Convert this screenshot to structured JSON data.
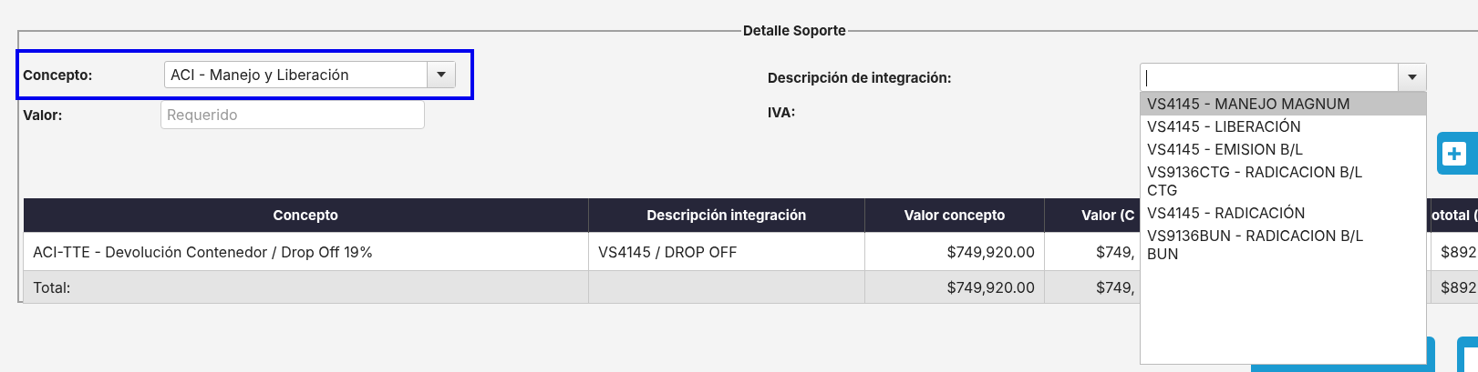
{
  "legend": "Detalle Soporte",
  "concepto": {
    "label": "Concepto:",
    "value": "ACI - Manejo y Liberación",
    "highlighted": true
  },
  "valor": {
    "label": "Valor:",
    "placeholder": "Requerido"
  },
  "descripcion": {
    "label": "Descripción de integración:",
    "expanded": true,
    "options": [
      {
        "label": "VS4145 - MANEJO MAGNUM",
        "selected": true
      },
      {
        "label": "VS4145 - LIBERACIÓN",
        "selected": false
      },
      {
        "label": "VS4145 - EMISION B/L",
        "selected": false
      },
      {
        "label": "VS9136CTG - RADICACION B/L CTG",
        "selected": false
      },
      {
        "label": "VS4145 - RADICACIÓN",
        "selected": false
      },
      {
        "label": "VS9136BUN - RADICACION B/L BUN",
        "selected": false
      }
    ]
  },
  "iva": {
    "label": "IVA:"
  },
  "table": {
    "columns": [
      "Concepto",
      "Descripción integración",
      "Valor concepto",
      "Valor (C",
      "ototal ("
    ],
    "rows": [
      {
        "kind": "item",
        "cells": [
          "ACI-TTE - Devolución Contenedor / Drop Off 19%",
          "VS4145 / DROP OFF",
          "$749,920.00",
          "$749,",
          "$892"
        ]
      },
      {
        "kind": "total",
        "cells": [
          "Total:",
          null,
          "$749,920.00",
          "$749,",
          "$892"
        ]
      }
    ]
  }
}
